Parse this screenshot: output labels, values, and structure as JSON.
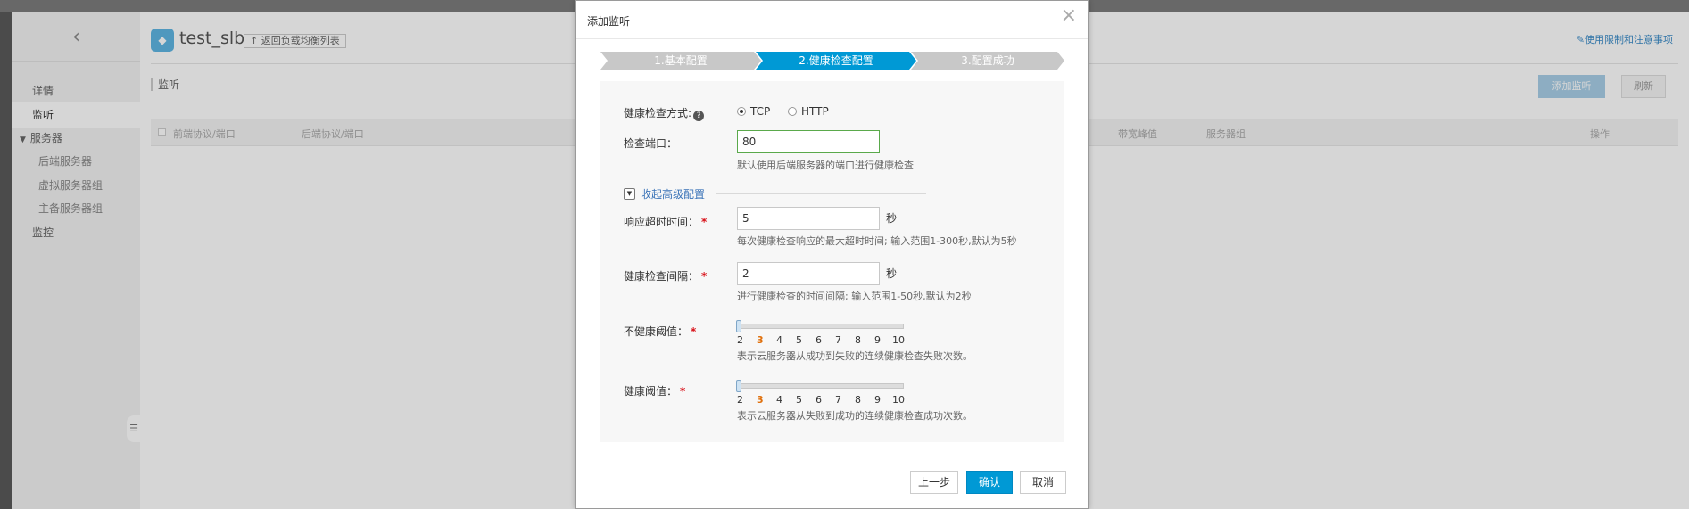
{
  "sidebar": {
    "items": [
      {
        "label": "详情"
      },
      {
        "label": "监听"
      },
      {
        "label": "服务器"
      },
      {
        "label": "后端服务器"
      },
      {
        "label": "虚拟服务器组"
      },
      {
        "label": "主备服务器组"
      },
      {
        "label": "监控"
      }
    ]
  },
  "header": {
    "title": "test_slb",
    "return_label": "返回负载均衡列表",
    "help_link": "使用限制和注意事项"
  },
  "listener_section": {
    "title": "监听",
    "add_button": "添加监听",
    "refresh_button": "刷新",
    "columns": [
      "前端协议/端口",
      "后端协议/端口",
      "带宽峰值",
      "服务器组",
      "操作"
    ]
  },
  "modal": {
    "title": "添加监听",
    "steps": [
      {
        "label": "1.基本配置",
        "state": "done"
      },
      {
        "label": "2.健康检查配置",
        "state": "active"
      },
      {
        "label": "3.配置成功",
        "state": "todo"
      }
    ],
    "health_method": {
      "label": "健康检查方式:",
      "options": [
        "TCP",
        "HTTP"
      ],
      "selected": "TCP"
    },
    "check_port": {
      "label": "检查端口：",
      "value": "80",
      "hint": "默认使用后端服务器的端口进行健康检查"
    },
    "advanced_toggle": "收起高级配置",
    "timeout": {
      "label": "响应超时时间：",
      "value": "5",
      "unit": "秒",
      "hint": "每次健康检查响应的最大超时时间; 输入范围1-300秒,默认为5秒"
    },
    "interval": {
      "label": "健康检查间隔：",
      "value": "2",
      "unit": "秒",
      "hint": "进行健康检查的时间间隔; 输入范围1-50秒,默认为2秒"
    },
    "unhealthy_threshold": {
      "label": "不健康阈值：",
      "ticks": [
        "2",
        "3",
        "4",
        "5",
        "6",
        "7",
        "8",
        "9",
        "10"
      ],
      "selected": "3",
      "hint": "表示云服务器从成功到失败的连续健康检查失败次数。"
    },
    "healthy_threshold": {
      "label": "健康阈值：",
      "ticks": [
        "2",
        "3",
        "4",
        "5",
        "6",
        "7",
        "8",
        "9",
        "10"
      ],
      "selected": "3",
      "hint": "表示云服务器从失败到成功的连续健康检查成功次数。"
    },
    "buttons": {
      "prev": "上一步",
      "confirm": "确认",
      "cancel": "取消"
    }
  },
  "colors": {
    "step_active": "#0099d5",
    "step_inactive": "#c8c8c8",
    "primary_button": "#0099d5",
    "focus_border": "#5aa94b",
    "required": "#d9121a"
  }
}
